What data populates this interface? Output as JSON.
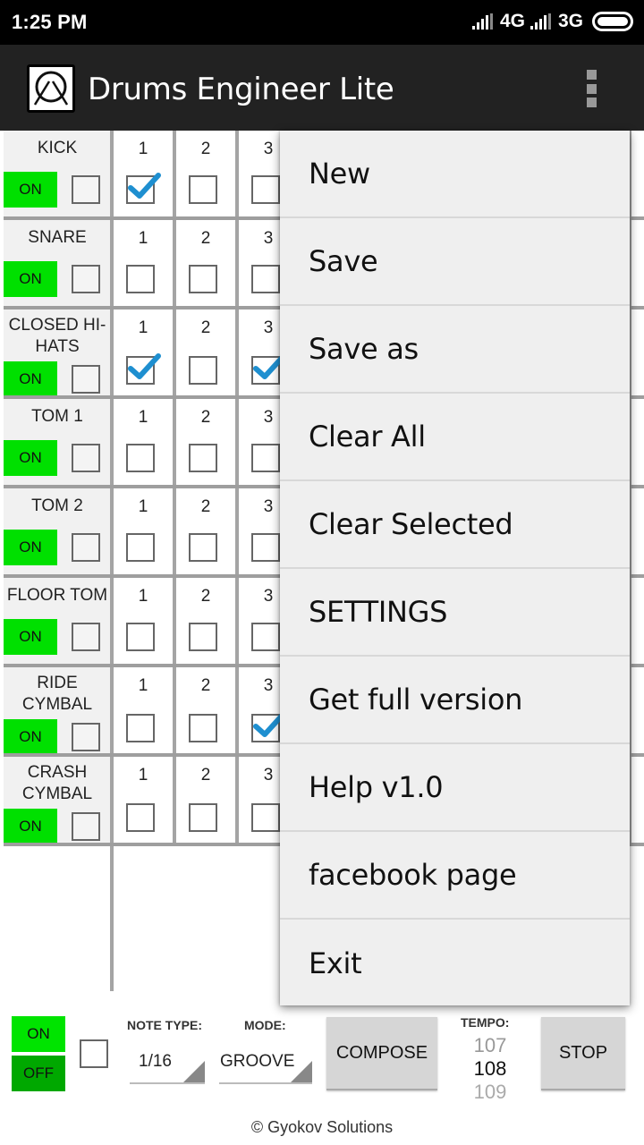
{
  "status_bar": {
    "time": "1:25 PM",
    "network_1": "4G",
    "network_2": "3G",
    "icons": [
      "signal-icon",
      "signal-icon",
      "battery-icon"
    ]
  },
  "app_bar": {
    "title": "Drums Engineer Lite",
    "icon": "drum-logo-icon",
    "overflow_icon": "more-vert-icon"
  },
  "tracks": [
    {
      "name": "KICK",
      "on_label": "ON",
      "steps": [
        {
          "num": "1",
          "checked": true
        },
        {
          "num": "2",
          "checked": false
        },
        {
          "num": "3",
          "checked": false
        }
      ],
      "right_edge_checked": true
    },
    {
      "name": "SNARE",
      "on_label": "ON",
      "steps": [
        {
          "num": "1",
          "checked": false
        },
        {
          "num": "2",
          "checked": false
        },
        {
          "num": "3",
          "checked": false
        }
      ],
      "right_edge_checked": false
    },
    {
      "name": "CLOSED HI-HATS",
      "on_label": "ON",
      "steps": [
        {
          "num": "1",
          "checked": true
        },
        {
          "num": "2",
          "checked": false
        },
        {
          "num": "3",
          "checked": true
        }
      ],
      "right_edge_checked": true
    },
    {
      "name": "TOM 1",
      "on_label": "ON",
      "steps": [
        {
          "num": "1",
          "checked": false
        },
        {
          "num": "2",
          "checked": false
        },
        {
          "num": "3",
          "checked": false
        }
      ],
      "right_edge_checked": true
    },
    {
      "name": "TOM 2",
      "on_label": "ON",
      "steps": [
        {
          "num": "1",
          "checked": false
        },
        {
          "num": "2",
          "checked": false
        },
        {
          "num": "3",
          "checked": false
        }
      ],
      "right_edge_checked": false
    },
    {
      "name": "FLOOR TOM",
      "on_label": "ON",
      "steps": [
        {
          "num": "1",
          "checked": false
        },
        {
          "num": "2",
          "checked": false
        },
        {
          "num": "3",
          "checked": false
        }
      ],
      "right_edge_checked": false
    },
    {
      "name": "RIDE CYMBAL",
      "on_label": "ON",
      "steps": [
        {
          "num": "1",
          "checked": false
        },
        {
          "num": "2",
          "checked": false
        },
        {
          "num": "3",
          "checked": true
        }
      ],
      "right_edge_checked": false
    },
    {
      "name": "CRASH CYMBAL",
      "on_label": "ON",
      "steps": [
        {
          "num": "1",
          "checked": false
        },
        {
          "num": "2",
          "checked": false
        },
        {
          "num": "3",
          "checked": false
        }
      ],
      "right_edge_checked": false
    }
  ],
  "controls": {
    "on_label": "ON",
    "off_label": "OFF",
    "note_type_label": "NOTE TYPE:",
    "note_type_value": "1/16",
    "mode_label": "MODE:",
    "mode_value": "GROOVE",
    "compose_label": "COMPOSE",
    "tempo_label": "TEMPO:",
    "tempo_prev": "107",
    "tempo_value": "108",
    "tempo_next": "109",
    "stop_label": "STOP"
  },
  "footer": "© Gyokov Solutions",
  "menu": {
    "items": [
      "New",
      "Save",
      "Save as",
      "Clear All",
      "Clear Selected",
      "SETTINGS",
      "Get full version",
      "Help v1.0",
      "facebook page",
      "Exit"
    ]
  },
  "colors": {
    "on_green": "#00e000",
    "off_green": "#00a800",
    "check_blue": "#1e8fd0",
    "app_bar": "#222222",
    "menu_bg": "#efefef"
  }
}
